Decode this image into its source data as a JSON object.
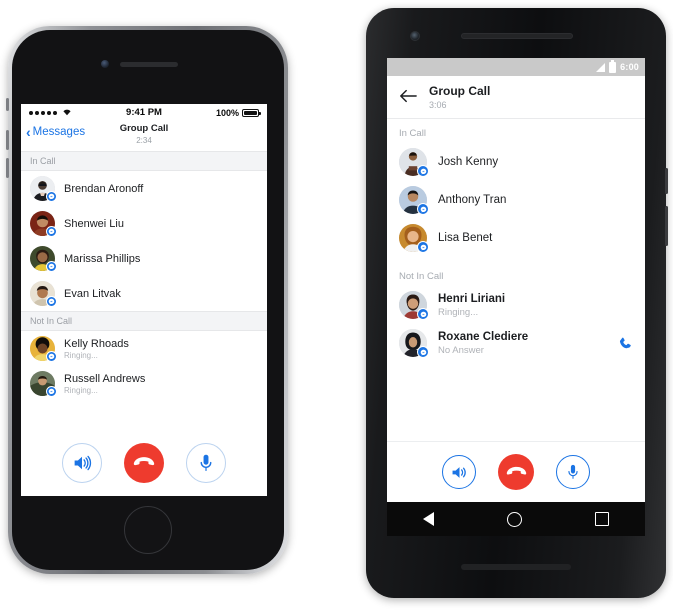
{
  "meta": {
    "scene": "Facebook Messenger group call screens on iPhone and Android"
  },
  "colors": {
    "accent_blue": "#1b74e4",
    "hangup_red": "#ee3b2e",
    "section_grey": "#9a9ea4",
    "text_primary": "#1c1e21",
    "text_secondary": "#b0b3b8",
    "ios_bezel": "#8e9095",
    "android_bezel": "#0d0e10"
  },
  "iphone": {
    "status_bar": {
      "carrier_dots": 5,
      "wifi_icon": "wifi-icon",
      "time": "9:41 PM",
      "battery_percent": "100%",
      "battery_icon": "battery-full-icon"
    },
    "nav": {
      "back_icon": "chevron-left-icon",
      "back_label": "Messages",
      "title": "Group Call",
      "timer": "2:34"
    },
    "sections": [
      {
        "header": "In Call",
        "contacts": [
          {
            "name": "Brendan Aronoff",
            "status": "",
            "badge": "messenger-badge-icon",
            "avatar": "avatar-brendan"
          },
          {
            "name": "Shenwei Liu",
            "status": "",
            "badge": "messenger-badge-icon",
            "avatar": "avatar-shenwei"
          },
          {
            "name": "Marissa Phillips",
            "status": "",
            "badge": "messenger-badge-icon",
            "avatar": "avatar-marissa"
          },
          {
            "name": "Evan Litvak",
            "status": "",
            "badge": "messenger-badge-icon",
            "avatar": "avatar-evan"
          }
        ]
      },
      {
        "header": "Not In Call",
        "contacts": [
          {
            "name": "Kelly Rhoads",
            "status": "Ringing...",
            "badge": "messenger-badge-icon",
            "avatar": "avatar-kelly"
          },
          {
            "name": "Russell Andrews",
            "status": "Ringing...",
            "badge": "messenger-badge-icon",
            "avatar": "avatar-russell"
          }
        ]
      }
    ],
    "controls": [
      {
        "name": "speaker-button",
        "icon": "speaker-icon",
        "style": "outline"
      },
      {
        "name": "hang-up-button",
        "icon": "phone-hangup-icon",
        "style": "hangup"
      },
      {
        "name": "microphone-button",
        "icon": "microphone-icon",
        "style": "outline"
      }
    ]
  },
  "android": {
    "status_bar": {
      "signal_icon": "signal-icon",
      "battery_icon": "battery-icon",
      "time": "6:00"
    },
    "appbar": {
      "back_icon": "arrow-left-icon",
      "title": "Group Call",
      "timer": "3:06"
    },
    "sections": [
      {
        "header": "In Call",
        "contacts": [
          {
            "name": "Josh Kenny",
            "status": "",
            "badge": "messenger-badge-icon",
            "avatar": "avatar-josh",
            "action_icon": ""
          },
          {
            "name": "Anthony Tran",
            "status": "",
            "badge": "messenger-badge-icon",
            "avatar": "avatar-anthony",
            "action_icon": ""
          },
          {
            "name": "Lisa Benet",
            "status": "",
            "badge": "messenger-badge-icon",
            "avatar": "avatar-lisa",
            "action_icon": ""
          }
        ]
      },
      {
        "header": "Not In Call",
        "contacts": [
          {
            "name": "Henri Liriani",
            "status": "Ringing...",
            "badge": "messenger-badge-icon",
            "avatar": "avatar-henri",
            "action_icon": ""
          },
          {
            "name": "Roxane Clediere",
            "status": "No Answer",
            "badge": "messenger-badge-icon",
            "avatar": "avatar-roxane",
            "action_icon": "phone-call-icon"
          }
        ]
      }
    ],
    "controls": [
      {
        "name": "speaker-button",
        "icon": "speaker-icon",
        "style": "outline"
      },
      {
        "name": "hang-up-button",
        "icon": "phone-hangup-icon",
        "style": "hangup"
      },
      {
        "name": "microphone-button",
        "icon": "microphone-icon",
        "style": "outline"
      }
    ],
    "navbar": [
      {
        "name": "nav-back-button",
        "icon": "triangle-back-icon"
      },
      {
        "name": "nav-home-button",
        "icon": "circle-home-icon"
      },
      {
        "name": "nav-recents-button",
        "icon": "square-recents-icon"
      }
    ]
  }
}
